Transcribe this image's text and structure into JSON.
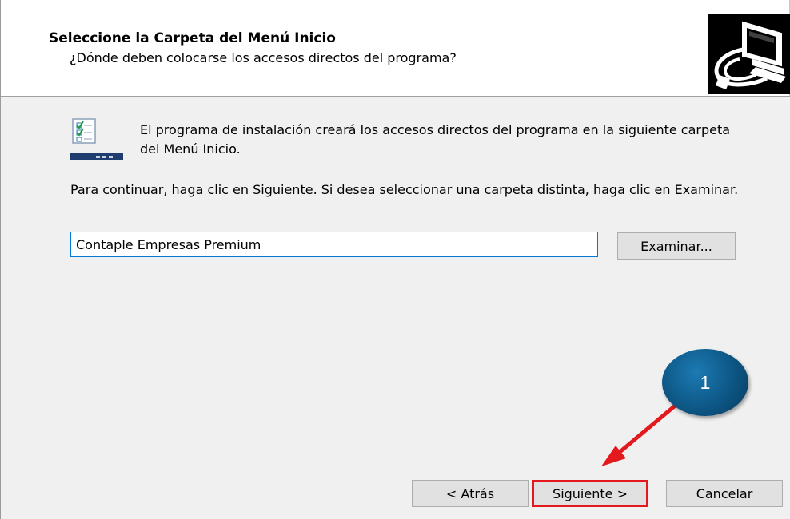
{
  "header": {
    "title": "Seleccione la Carpeta del Menú Inicio",
    "subtitle": "¿Dónde deben colocarse los accesos directos del programa?",
    "wizard_image_icon": "computer-install-icon"
  },
  "content": {
    "icon": "start-menu-folder-icon",
    "intro_text": "El programa de instalación creará los accesos directos del programa en la siguiente carpeta del Menú Inicio.",
    "instruction_text": "Para continuar, haga clic en Siguiente. Si desea seleccionar una carpeta distinta, haga clic en Examinar.",
    "folder_value": "Contaple Empresas Premium",
    "browse_label": "Examinar..."
  },
  "footer": {
    "back_label": "< Atrás",
    "next_label": "Siguiente >",
    "cancel_label": "Cancelar"
  },
  "annotation": {
    "step_number": "1",
    "circle_color": "#0d5684",
    "arrow_color": "#e3191d",
    "highlight_color": "#e3191d"
  }
}
